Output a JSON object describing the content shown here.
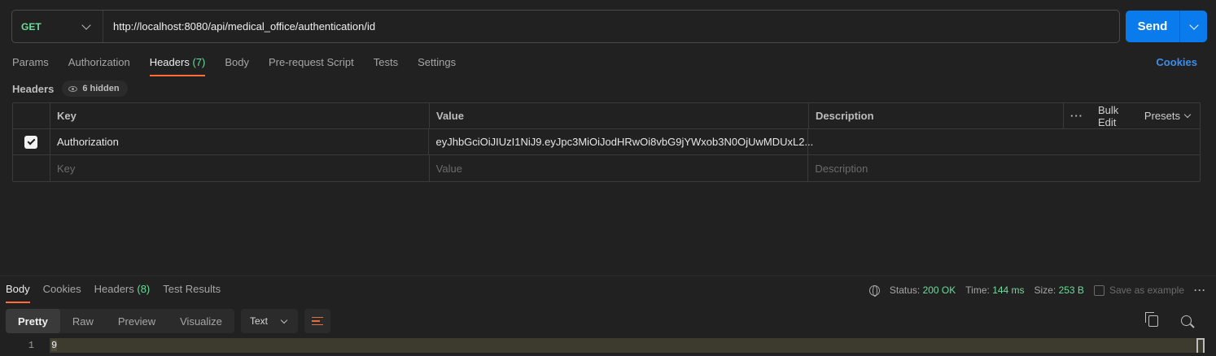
{
  "request": {
    "method": "GET",
    "url": "http://localhost:8080/api/medical_office/authentication/id",
    "send_label": "Send"
  },
  "request_tabs": [
    {
      "label": "Params",
      "count": ""
    },
    {
      "label": "Authorization",
      "count": ""
    },
    {
      "label": "Headers",
      "count": "(7)"
    },
    {
      "label": "Body",
      "count": ""
    },
    {
      "label": "Pre-request Script",
      "count": ""
    },
    {
      "label": "Tests",
      "count": ""
    },
    {
      "label": "Settings",
      "count": ""
    }
  ],
  "cookies_link": "Cookies",
  "headers_section": {
    "title": "Headers",
    "hidden_label": "6 hidden",
    "columns": {
      "key": "Key",
      "value": "Value",
      "description": "Description"
    },
    "tools": {
      "bulk_edit": "Bulk Edit",
      "presets": "Presets"
    },
    "rows": [
      {
        "checked": true,
        "key": "Authorization",
        "value": "eyJhbGciOiJIUzI1NiJ9.eyJpc3MiOiJodHRwOi8vbG9jYWxob3N0OjUwMDUxL2...",
        "description": ""
      }
    ],
    "placeholders": {
      "key": "Key",
      "value": "Value",
      "description": "Description"
    }
  },
  "response_tabs": [
    {
      "label": "Body",
      "count": ""
    },
    {
      "label": "Cookies",
      "count": ""
    },
    {
      "label": "Headers",
      "count": "(8)"
    },
    {
      "label": "Test Results",
      "count": ""
    }
  ],
  "response_meta": {
    "status_label": "Status:",
    "status_value": "200 OK",
    "time_label": "Time:",
    "time_value": "144 ms",
    "size_label": "Size:",
    "size_value": "253 B",
    "save_example": "Save as example"
  },
  "view_modes": [
    "Pretty",
    "Raw",
    "Preview",
    "Visualize"
  ],
  "format": "Text",
  "body_lines": [
    {
      "num": "1",
      "text": "9"
    }
  ],
  "colors": {
    "accent": "#ff6c37",
    "send": "#097bed",
    "success": "#6bdd9a",
    "link": "#3d8ee8"
  }
}
